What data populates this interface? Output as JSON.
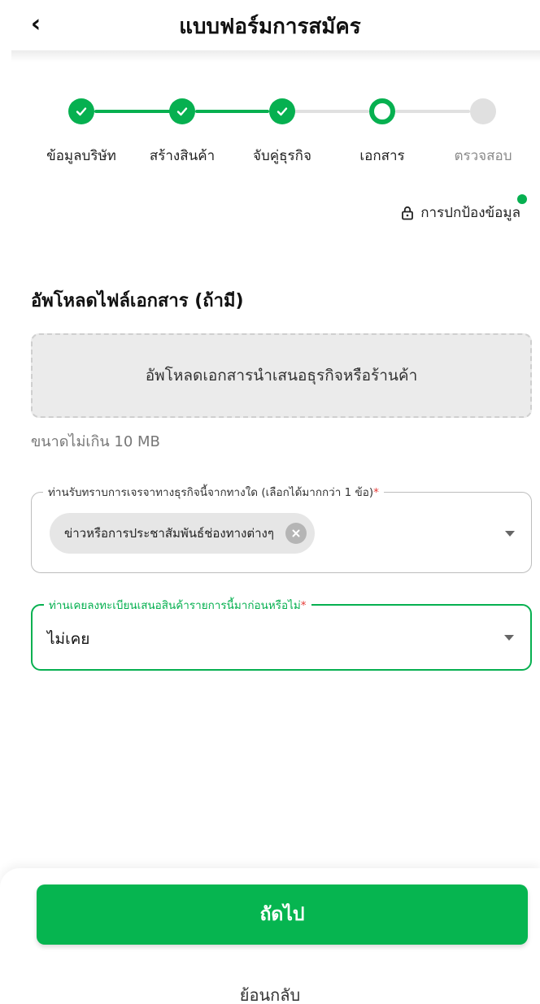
{
  "header": {
    "back_icon": "chevron-left-icon",
    "title": "แบบฟอร์มการสมัคร"
  },
  "stepper": {
    "steps": [
      {
        "label": "ข้อมูลบริษัท",
        "status": "done"
      },
      {
        "label": "สร้างสินค้า",
        "status": "done"
      },
      {
        "label": "จับคู่ธุรกิจ",
        "status": "done"
      },
      {
        "label": "เอกสาร",
        "status": "current"
      },
      {
        "label": "ตรวจสอบ",
        "status": "todo"
      }
    ]
  },
  "privacy": {
    "label": "การปกป้องข้อมูล",
    "icon": "lock-icon"
  },
  "upload": {
    "title": "อัพโหลดไฟล์เอกสาร (ถ้ามี)",
    "box_text": "อัพโหลดเอกสารนำเสนอธุรกิจหรือร้านค้า",
    "size_note": "ขนาดไม่เกิน 10 MB"
  },
  "field_source": {
    "label": "ท่านรับทราบการเจรจาทางธุรกิจนี้จากทางใด (เลือกได้มากกว่า 1 ข้อ)",
    "required_mark": "*",
    "selected_chip": "ข่าวหรือการประชาสัมพันธ์ช่องทางต่างๆ"
  },
  "field_registered": {
    "label": "ท่านเคยลงทะเบียนเสนอสินค้ารายการนี้มาก่อนหรือไม่",
    "required_mark": "*",
    "value": "ไม่เคย"
  },
  "actions": {
    "next_label": "ถัดไป",
    "back_label": "ย้อนกลับ"
  },
  "colors": {
    "accent": "#06b050",
    "required": "#e53935",
    "inactive": "#e0e0e0"
  }
}
